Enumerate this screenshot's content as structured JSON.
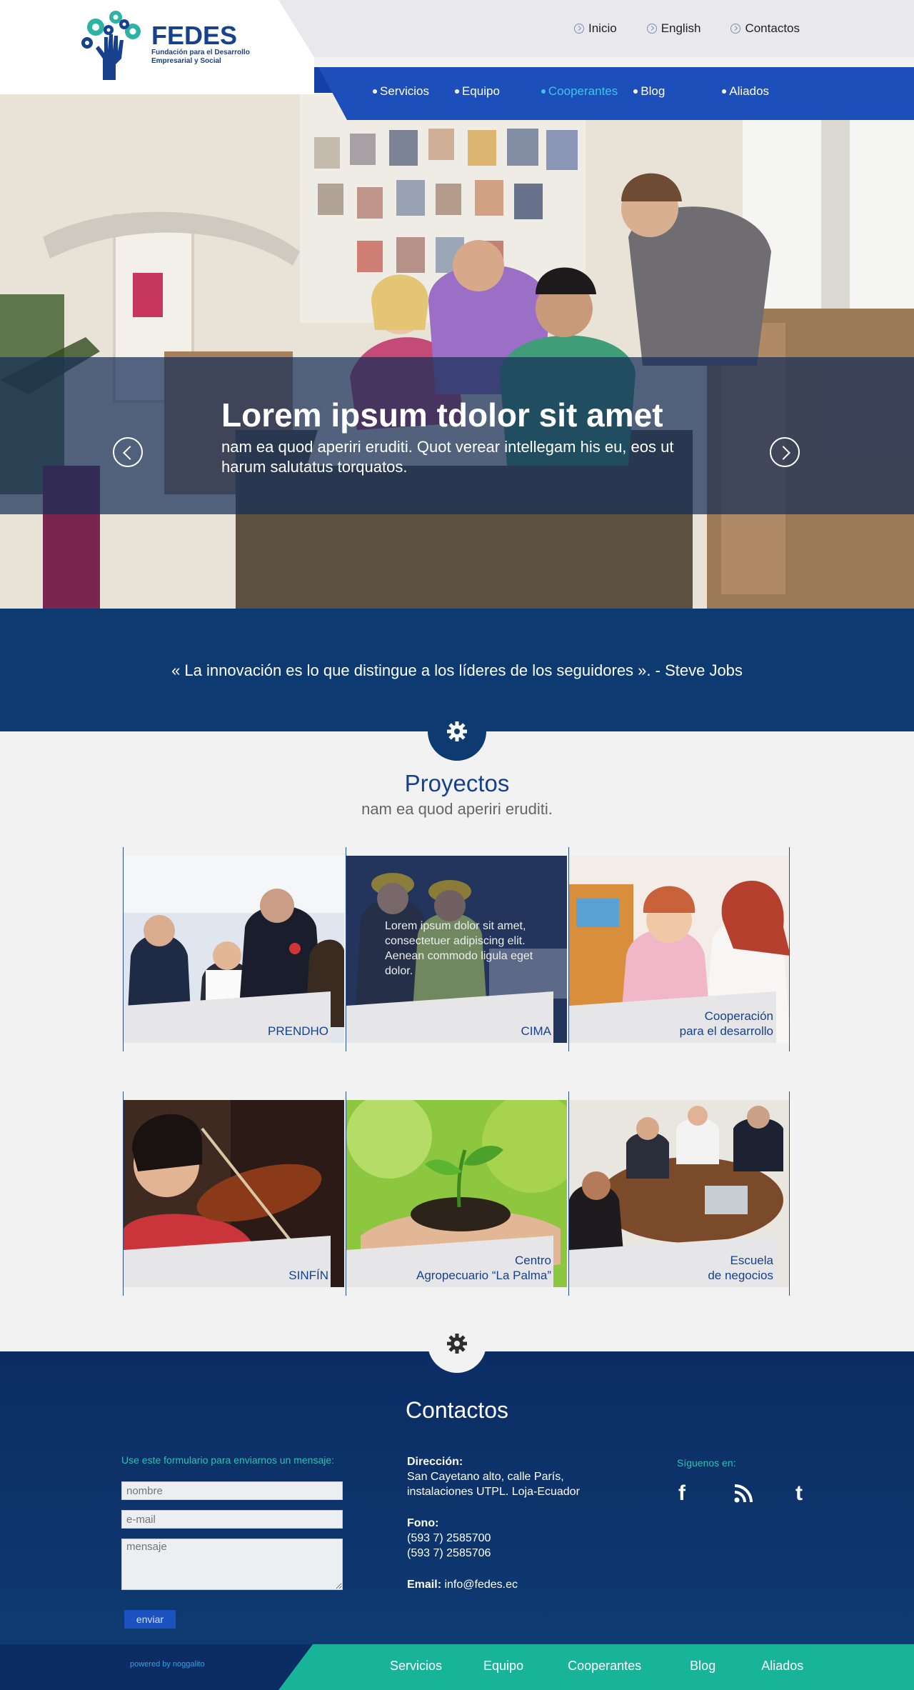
{
  "header": {
    "logo_name": "FEDES",
    "logo_sub_1": "Fundación para el Desarrollo",
    "logo_sub_2": "Empresarial y Social",
    "top_links": [
      "Inicio",
      "English",
      "Contactos"
    ],
    "nav": [
      "Servicios",
      "Equipo",
      "Cooperantes",
      "Blog",
      "Aliados"
    ],
    "nav_active": "Cooperantes"
  },
  "hero": {
    "title": "Lorem ipsum tdolor sit amet",
    "text": "nam ea quod aperiri eruditi. Quot verear intellegam his eu, eos ut harum salutatus torquatos."
  },
  "quote": "« La innovación es lo que distingue a los líderes de los seguidores ». - Steve Jobs",
  "projects": {
    "title": "Proyectos",
    "subtitle": "nam ea quod aperiri eruditi.",
    "items": [
      {
        "label": "PRENDHO"
      },
      {
        "label": "CIMA",
        "overlay": "Lorem ipsum dolor sit amet, consectetuer adipiscing elit. Aenean commodo ligula eget dolor."
      },
      {
        "label": "Cooperación\npara el desarrollo"
      },
      {
        "label": "SINFÍN"
      },
      {
        "label": "Centro\nAgropecuario  “La Palma”"
      },
      {
        "label": "Escuela\nde negocios"
      }
    ]
  },
  "contact": {
    "title": "Contactos",
    "form_label": "Use este formulario para enviarnos un mensaje:",
    "name_placeholder": "nombre",
    "email_placeholder": "e-mail",
    "message_placeholder": "mensaje",
    "send": "enviar",
    "address_label": "Dirección:",
    "address_1": "San Cayetano alto, calle París,",
    "address_2": "instalaciones UTPL. Loja-Ecuador",
    "phone_label": "Fono:",
    "phone_1": "(593 7) 2585700",
    "phone_2": "(593 7) 2585706",
    "email_label": "Email:",
    "email": "info@fedes.ec",
    "follow": "Síguenos en:"
  },
  "footer": {
    "powered": "powered by noggalito",
    "nav": [
      "Servicios",
      "Equipo",
      "Cooperantes",
      "Blog",
      "Aliados"
    ]
  },
  "colors": {
    "brand_blue": "#17418c",
    "nav_blue": "#1c4fb9",
    "accent_teal": "#18b49a",
    "active_cyan": "#3fc3f0"
  }
}
